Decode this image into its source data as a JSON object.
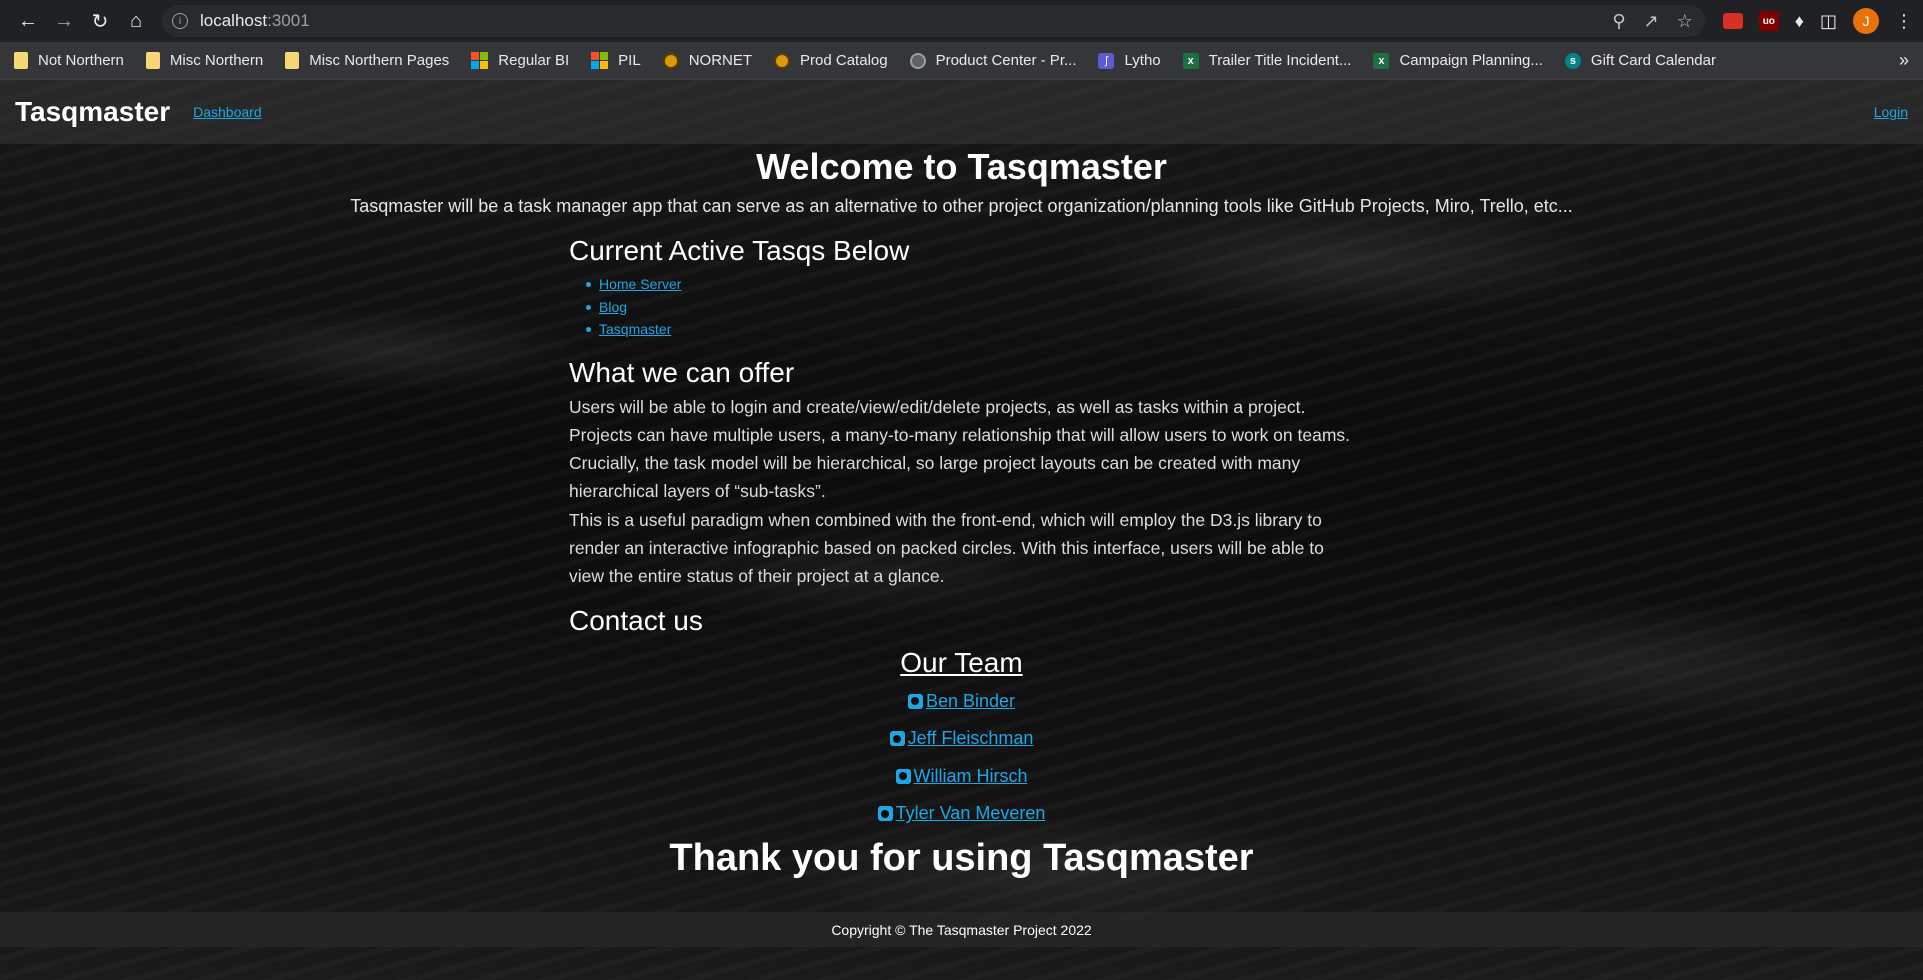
{
  "browser": {
    "url_host": "localhost",
    "url_port": ":3001",
    "avatar_letter": "J",
    "bookmarks": [
      {
        "label": "Not Northern",
        "icon": "folder-icon"
      },
      {
        "label": "Misc Northern",
        "icon": "folder-icon"
      },
      {
        "label": "Misc Northern Pages",
        "icon": "folder-icon"
      },
      {
        "label": "Regular BI",
        "icon": "microsoft-icon"
      },
      {
        "label": "PIL",
        "icon": "microsoft-icon"
      },
      {
        "label": "NORNET",
        "icon": "nornet-icon"
      },
      {
        "label": "Prod Catalog",
        "icon": "nornet-icon"
      },
      {
        "label": "Product Center - Pr...",
        "icon": "globe-icon"
      },
      {
        "label": "Lytho",
        "icon": "lytho-icon"
      },
      {
        "label": "Trailer Title Incident...",
        "icon": "excel-icon"
      },
      {
        "label": "Campaign Planning...",
        "icon": "excel-icon"
      },
      {
        "label": "Gift Card Calendar",
        "icon": "sharepoint-icon"
      }
    ],
    "more_label": "»"
  },
  "site": {
    "brand": "Tasqmaster",
    "nav_dashboard": "Dashboard",
    "nav_login": "Login"
  },
  "main": {
    "welcome": "Welcome to Tasqmaster",
    "intro": "Tasqmaster will be a task manager app that can serve as an alternative to other project organization/planning tools like GitHub Projects, Miro, Trello, etc...",
    "active_heading": "Current Active Tasqs Below",
    "active_tasqs": [
      "Home Server",
      "Blog",
      "Tasqmaster"
    ],
    "offer_heading": "What we can offer",
    "offer_p1": "Users will be able to login and create/view/edit/delete projects, as well as tasks within a project. Projects can have multiple users, a many-to-many relationship that will allow users to work on teams. Crucially, the task model will be hierarchical, so large project layouts can be created with many hierarchical layers of “sub-tasks”.",
    "offer_p2": "This is a useful paradigm when combined with the front-end, which will employ the D3.js library to render an interactive infographic based on packed circles. With this interface, users will be able to view the entire status of their project at a glance.",
    "contact_heading": "Contact us",
    "team_heading": "Our Team",
    "team": [
      "Ben Binder",
      "Jeff Fleischman",
      "William Hirsch",
      "Tyler Van Meveren"
    ],
    "thanks": "Thank you for using Tasqmaster"
  },
  "footer": {
    "copyright": "Copyright © The Tasqmaster Project 2022"
  },
  "colors": {
    "link": "#1ea7e6",
    "avatar": "#e8710a"
  }
}
